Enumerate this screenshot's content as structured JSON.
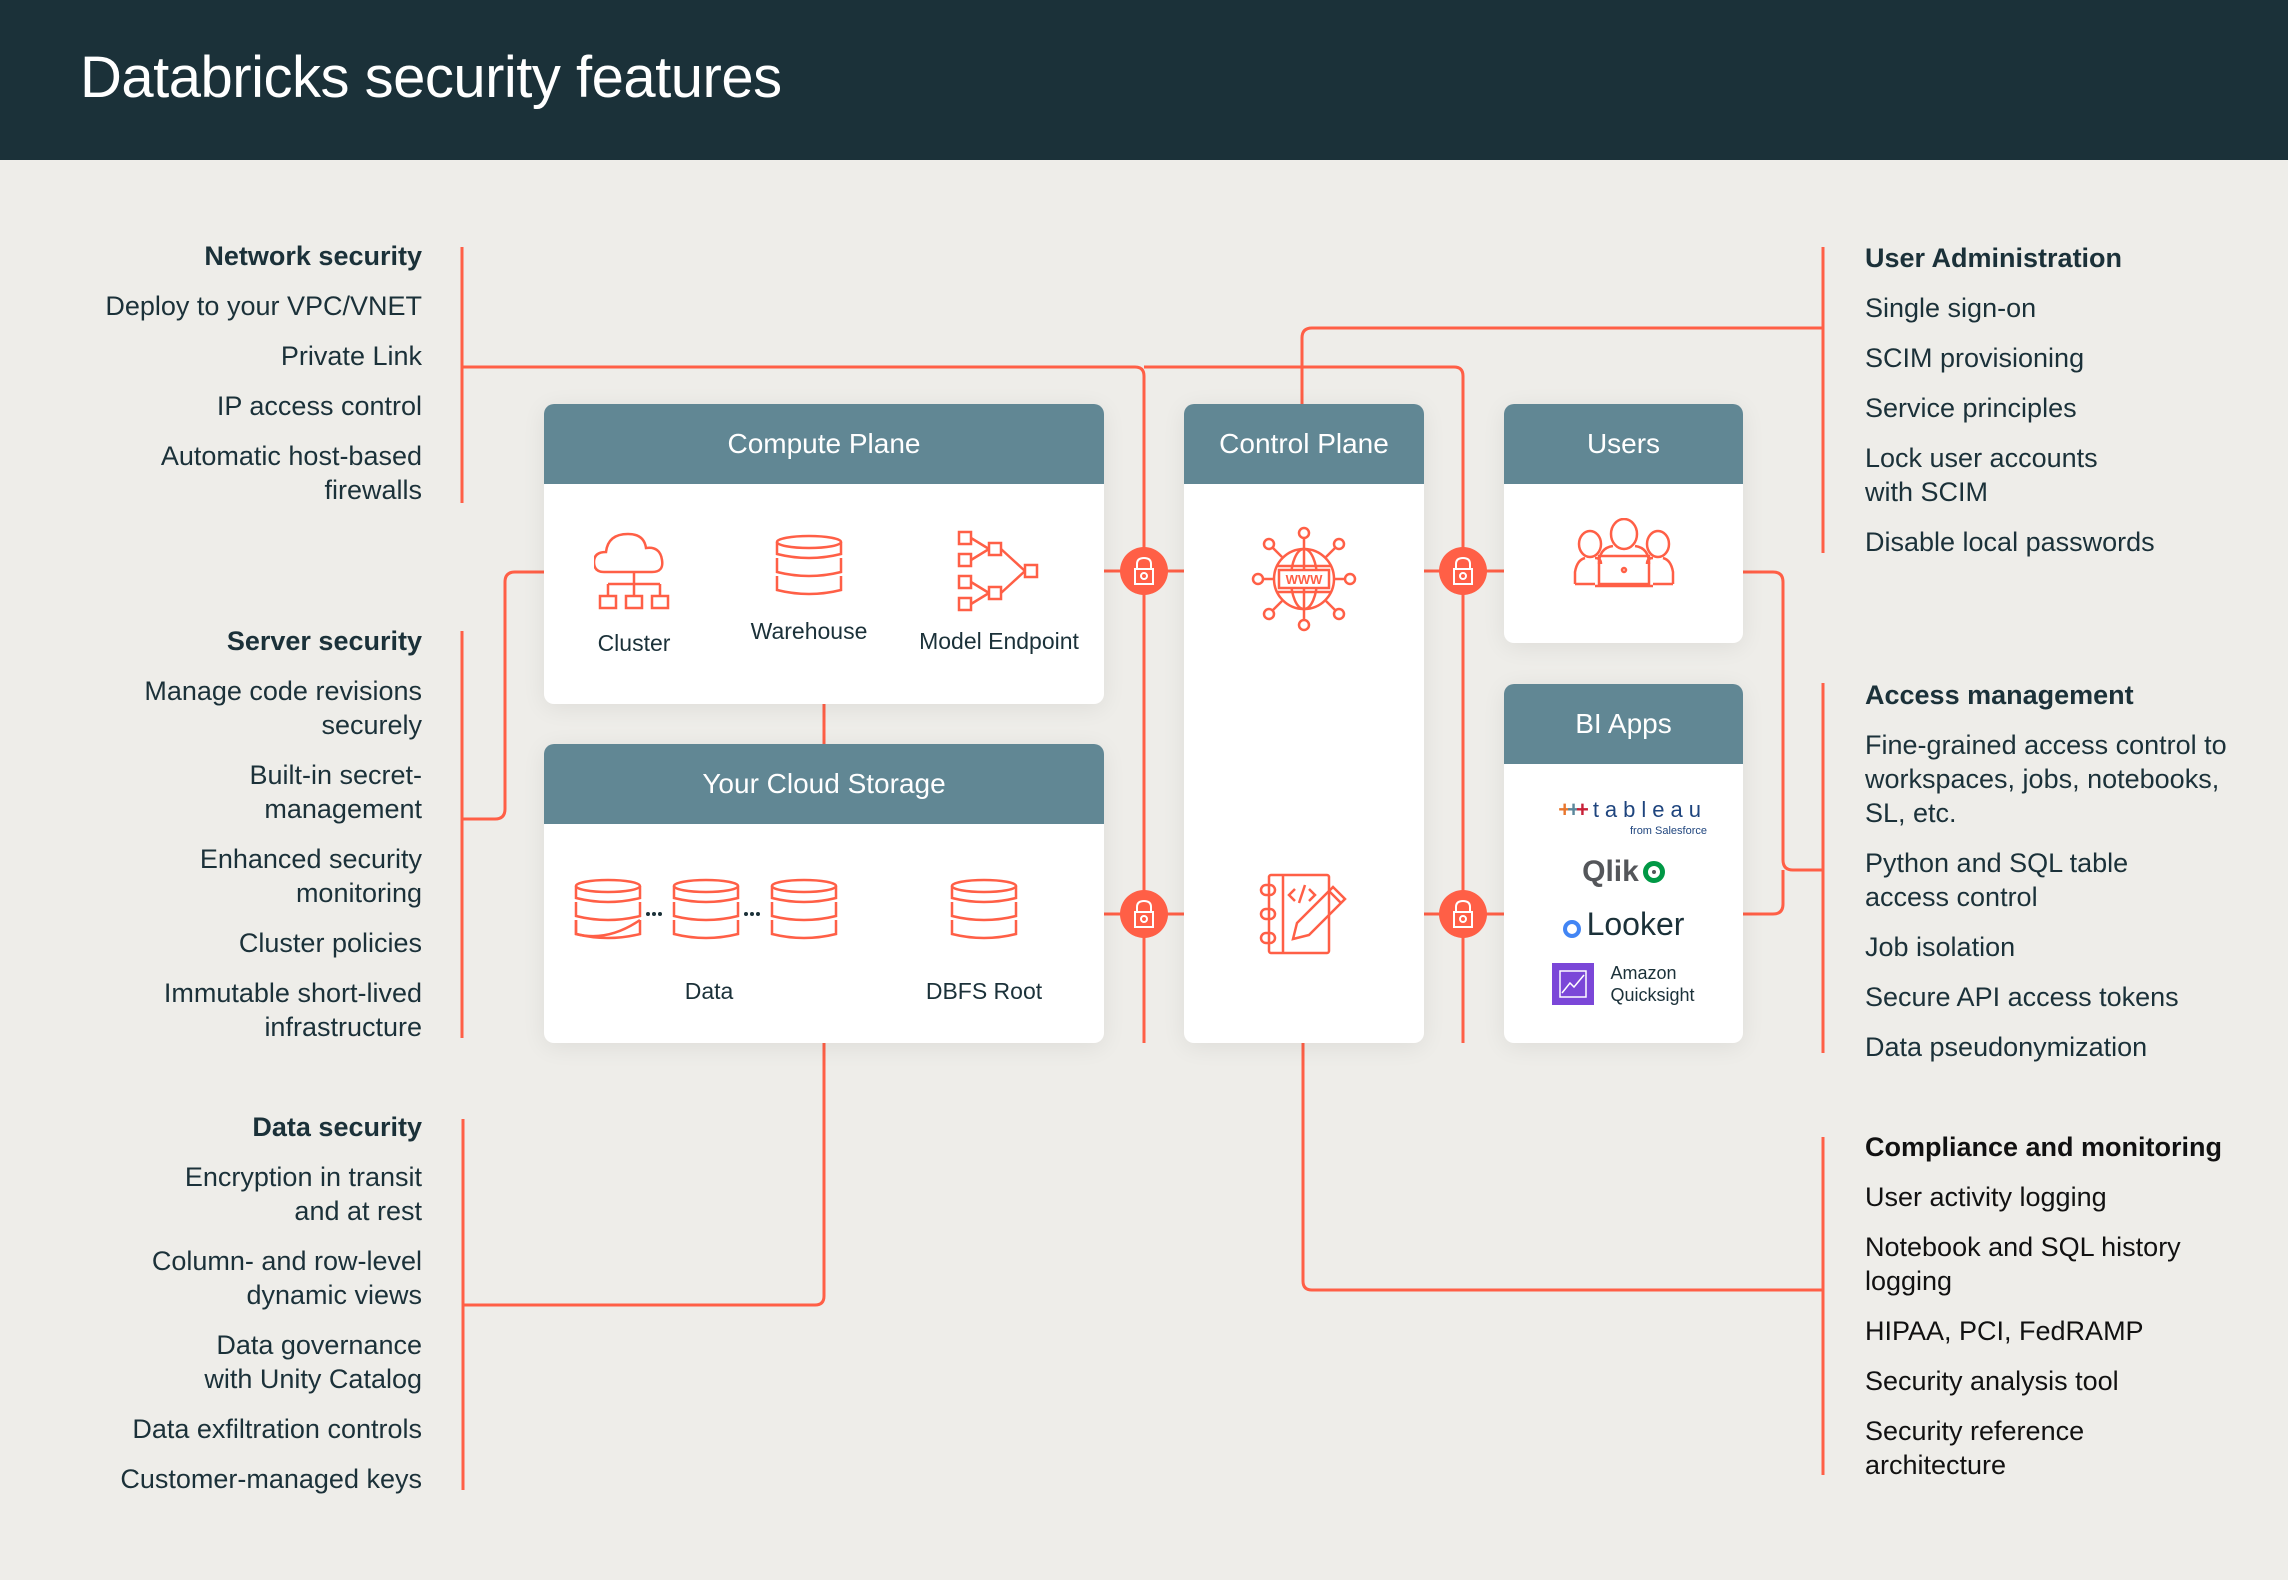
{
  "header": {
    "title": "Databricks security features"
  },
  "colors": {
    "header_bg": "#1b3139",
    "background": "#eeede9",
    "box_header": "#618794",
    "accent": "#ff5f46",
    "text": "#1b3139"
  },
  "diagram": {
    "compute_plane": {
      "title": "Compute Plane",
      "items": [
        {
          "label": "Cluster",
          "icon": "cloud-cluster-icon"
        },
        {
          "label": "Warehouse",
          "icon": "database-icon"
        },
        {
          "label": "Model Endpoint",
          "icon": "model-network-icon"
        }
      ]
    },
    "cloud_storage": {
      "title": "Your Cloud Storage",
      "items": [
        {
          "label": "Data",
          "icon": "multi-database-icon"
        },
        {
          "label": "DBFS Root",
          "icon": "database-icon"
        }
      ]
    },
    "control_plane": {
      "title": "Control Plane",
      "icons": [
        "www-globe-icon",
        "notebook-code-icon"
      ]
    },
    "users": {
      "title": "Users",
      "icon": "users-laptop-icon"
    },
    "bi_apps": {
      "title": "BI Apps",
      "apps": [
        {
          "name": "tableau",
          "sub": "from Salesforce"
        },
        {
          "name": "Qlik"
        },
        {
          "name": "Looker"
        },
        {
          "name": "Amazon Quicksight",
          "line1": "Amazon",
          "line2": "Quicksight"
        }
      ]
    },
    "locks": [
      "lock-icon",
      "lock-icon",
      "lock-icon",
      "lock-icon"
    ]
  },
  "feature_groups": {
    "network": {
      "title": "Network security",
      "items": [
        "Deploy to your VPC/VNET",
        "Private Link",
        "IP access control",
        "Automatic host-based firewalls"
      ]
    },
    "server": {
      "title": "Server security",
      "items": [
        "Manage code revisions securely",
        "Built-in secret-management",
        "Enhanced security monitoring",
        "Cluster policies",
        "Immutable short-lived infrastructure"
      ]
    },
    "data": {
      "title": "Data security",
      "items": [
        "Encryption in transit and at rest",
        "Column- and row-level dynamic views",
        "Data governance with Unity Catalog",
        "Data exfiltration controls",
        "Customer-managed keys"
      ]
    },
    "user_admin": {
      "title": "User Administration",
      "items": [
        "Single sign-on",
        "SCIM provisioning",
        "Service principles",
        "Lock user accounts with SCIM",
        "Disable local passwords"
      ]
    },
    "access": {
      "title": "Access management",
      "items": [
        "Fine-grained access control to workspaces, jobs, notebooks, SL, etc.",
        "Python and SQL table access control",
        "Job isolation",
        "Secure API access tokens",
        "Data pseudonymization"
      ]
    },
    "compliance": {
      "title": "Compliance and monitoring",
      "items": [
        "User activity logging",
        "Notebook and SQL history logging",
        "HIPAA, PCI, FedRAMP",
        "Security analysis tool",
        "Security reference architecture"
      ]
    }
  }
}
